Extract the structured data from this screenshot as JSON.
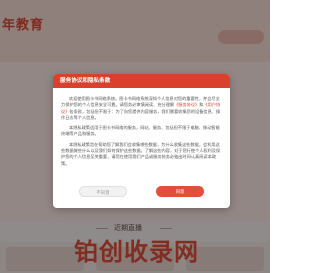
{
  "background": {
    "logo_text": "年教育",
    "subtitle": "",
    "section_title": "近期直播",
    "watermark": "铂创收录网"
  },
  "modal": {
    "title": "服务协议和隐私条款",
    "p1_a": "欢迎使用图卡书网络系统。图卡书网络系统深知个人信息对您的重要性，并会尽全力保护您的个人信息安全可靠。请您务必审慎阅读、充分理解",
    "link_service": "《服务协议》",
    "p1_b": "和",
    "link_privacy": "《用户协议》",
    "p1_c": "各条款，包括但不限于：为了向您提供内容服务，我们需要收集您的设备信息、操作日志等个人信息。",
    "p2": "本隐私政策适用于图卡书网络的服务，网站、服务、包括但不限于电脑、移动智能终端等产品和服务。",
    "p3": "本隐私政策旨在帮助您了解我们会收集哪些数据，为什么收集这些数据，会利用这些数据做些什么以及我们如何保护这些数据。了解这些内容，对于您行使个人权利及保护您的个人信息至关重要，请您在使用我们产品或服务前务必抽出时间认真阅读本政策。",
    "btn_disagree": "不同意",
    "btn_agree": "同意"
  }
}
